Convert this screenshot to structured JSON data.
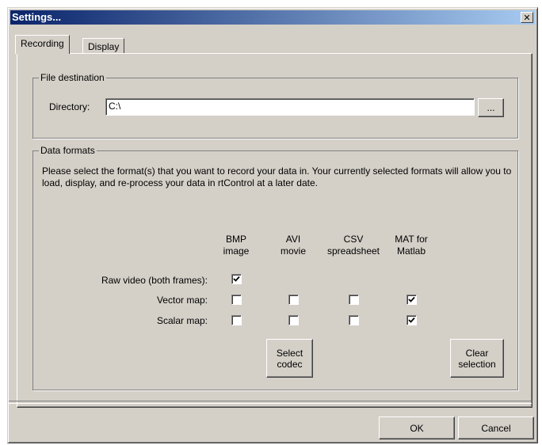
{
  "window": {
    "title": "Settings...",
    "close_glyph": "✕"
  },
  "tabs": [
    {
      "label": "Recording",
      "active": true
    },
    {
      "label": "Display",
      "active": false
    }
  ],
  "file_destination": {
    "legend": "File destination",
    "directory_label": "Directory:",
    "directory_value": "C:\\",
    "browse_label": "..."
  },
  "data_formats": {
    "legend": "Data formats",
    "description": "Please select the format(s) that you want to record your data in. Your currently selected formats will allow you to load, display, and re-process your data in rtControl at a later date.",
    "columns": [
      {
        "line1": "BMP",
        "line2": "image"
      },
      {
        "line1": "AVI",
        "line2": "movie"
      },
      {
        "line1": "CSV",
        "line2": "spreadsheet"
      },
      {
        "line1": "MAT for",
        "line2": "Matlab"
      }
    ],
    "rows": [
      {
        "label": "Raw video (both frames):",
        "checks": [
          true
        ]
      },
      {
        "label": "Vector map:",
        "checks": [
          false,
          false,
          false,
          true
        ]
      },
      {
        "label": "Scalar map:",
        "checks": [
          false,
          false,
          false,
          true
        ]
      }
    ],
    "select_codec": {
      "line1": "Select",
      "line2": "codec"
    },
    "clear_selection": {
      "line1": "Clear",
      "line2": "selection"
    }
  },
  "footer": {
    "ok_label": "OK",
    "cancel_label": "Cancel"
  }
}
